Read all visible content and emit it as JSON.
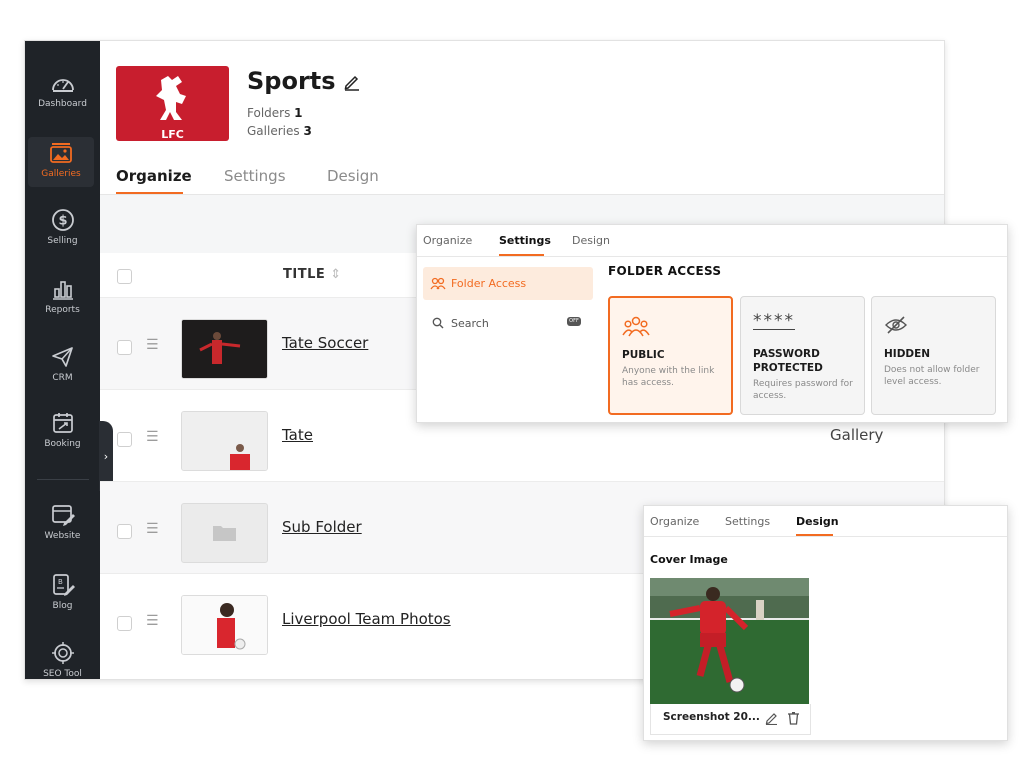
{
  "sidebar": {
    "items": [
      {
        "label": "Dashboard",
        "icon": "gauge-icon"
      },
      {
        "label": "Galleries",
        "icon": "image-icon",
        "active": true
      },
      {
        "label": "Selling",
        "icon": "dollar-circle-icon"
      },
      {
        "label": "Reports",
        "icon": "bar-chart-icon"
      },
      {
        "label": "CRM",
        "icon": "paper-plane-icon"
      },
      {
        "label": "Booking",
        "icon": "calendar-icon"
      },
      {
        "label": "Website",
        "icon": "website-edit-icon"
      },
      {
        "label": "Blog",
        "icon": "blog-edit-icon"
      },
      {
        "label": "SEO Tool",
        "icon": "seo-target-icon"
      }
    ],
    "toggle_glyph": "›"
  },
  "header": {
    "title": "Sports",
    "cover_text": "LFC",
    "folders_label": "Folders",
    "folders_count": "1",
    "galleries_label": "Galleries",
    "galleries_count": "3"
  },
  "tabs": {
    "organize": "Organize",
    "settings": "Settings",
    "design": "Design"
  },
  "table": {
    "title_header": "TITLE",
    "rows": [
      {
        "title": "Tate Soccer",
        "type": ""
      },
      {
        "title": "Tate",
        "type": "Gallery"
      },
      {
        "title": "Sub Folder",
        "type": ""
      },
      {
        "title": "Liverpool Team Photos",
        "type": ""
      }
    ]
  },
  "settings_overlay": {
    "tabs": [
      "Organize",
      "Settings",
      "Design"
    ],
    "active_tab": "Settings",
    "menu": {
      "folder_access": "Folder Access",
      "search": "Search",
      "search_badge": "OFF"
    },
    "heading": "FOLDER ACCESS",
    "options": [
      {
        "title_line1": "PUBLIC",
        "title_line2": "",
        "desc": "Anyone with the link has access.",
        "selected": true,
        "icon": "people-group-icon"
      },
      {
        "title_line1": "PASSWORD",
        "title_line2": "PROTECTED",
        "desc": "Requires password for access.",
        "selected": false,
        "icon": "password-asterisk-icon",
        "icon_text": "****"
      },
      {
        "title_line1": "HIDDEN",
        "title_line2": "",
        "desc": "Does not allow folder level access.",
        "selected": false,
        "icon": "eye-slash-icon"
      }
    ]
  },
  "design_overlay": {
    "tabs": [
      "Organize",
      "Settings",
      "Design"
    ],
    "active_tab": "Design",
    "cover_label": "Cover Image",
    "cover_caption": "Screenshot 20..."
  },
  "colors": {
    "accent": "#f26b21",
    "sidebar_bg": "#1f2328",
    "brand_red": "#c81e2e"
  }
}
